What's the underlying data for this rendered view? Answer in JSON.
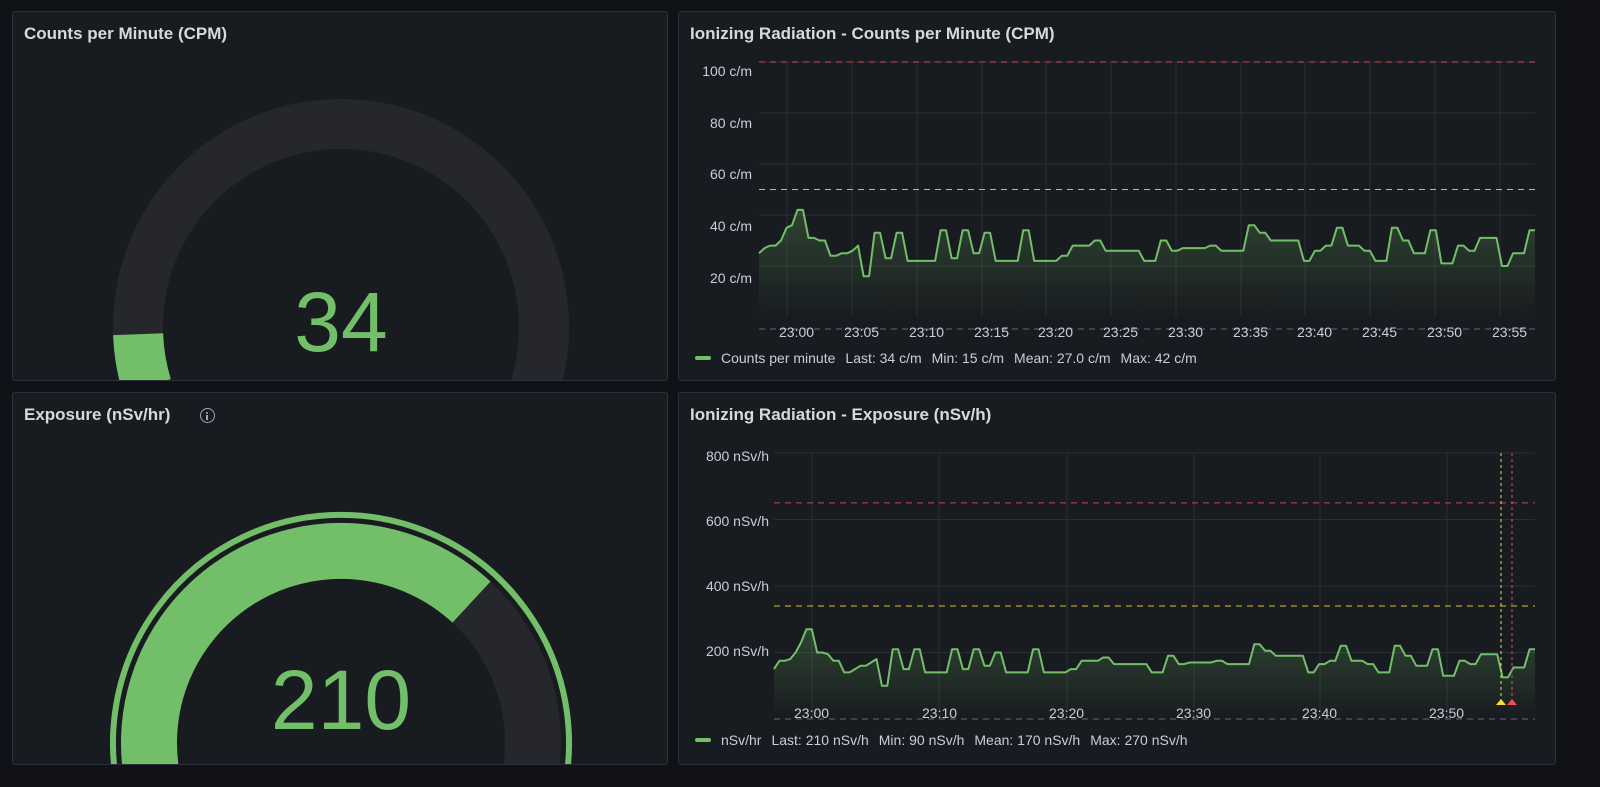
{
  "colors": {
    "green": "#73bf69",
    "track": "#25272d",
    "red": "#f2495c",
    "yellow": "#fade2a",
    "bg": "#181b1f"
  },
  "panels": {
    "cpm_gauge": {
      "title": "Counts per Minute (CPM)",
      "value": "34",
      "min": 0,
      "max": 100,
      "fraction": 0.34
    },
    "exposure_gauge": {
      "title": "Exposure (nSv/hr)",
      "value": "210",
      "info_icon": "info-icon",
      "fraction": 0.7
    },
    "cpm_chart": {
      "title": "Ionizing Radiation - Counts per Minute (CPM)",
      "y_ticks": [
        "100 c/m",
        "80 c/m",
        "60 c/m",
        "40 c/m",
        "20 c/m"
      ],
      "x_ticks": [
        "23:00",
        "23:05",
        "23:10",
        "23:15",
        "23:20",
        "23:25",
        "23:30",
        "23:35",
        "23:40",
        "23:45",
        "23:50",
        "23:55"
      ],
      "legend": {
        "series": "Counts per minute",
        "last": "Last: 34 c/m",
        "min": "Min: 15 c/m",
        "mean": "Mean: 27.0 c/m",
        "max": "Max: 42 c/m"
      }
    },
    "exposure_chart": {
      "title": "Ionizing Radiation - Exposure (nSv/h)",
      "y_ticks": [
        "800 nSv/h",
        "600 nSv/h",
        "400 nSv/h",
        "200 nSv/h"
      ],
      "x_ticks": [
        "23:00",
        "23:10",
        "23:20",
        "23:30",
        "23:40",
        "23:50"
      ],
      "legend": {
        "series": "nSv/hr",
        "last": "Last: 210 nSv/h",
        "min": "Min: 90 nSv/h",
        "mean": "Mean: 170 nSv/h",
        "max": "Max: 270 nSv/h"
      }
    }
  },
  "chart_data": [
    {
      "type": "line",
      "title": "Ionizing Radiation - Counts per Minute (CPM)",
      "unit": "c/m",
      "ylim": [
        0,
        100
      ],
      "x_range": [
        "22:58",
        "23:56"
      ],
      "thresholds": [
        {
          "value": 50,
          "color": "#fade2a"
        },
        {
          "value": 100,
          "color": "#f2495c"
        }
      ],
      "series": [
        {
          "name": "Counts per minute",
          "color": "#73bf69",
          "values": [
            25,
            27,
            28,
            28,
            30,
            35,
            36,
            42,
            42,
            31,
            31,
            30,
            30,
            24,
            24,
            25,
            25,
            26,
            28,
            16,
            16,
            33,
            33,
            23,
            23,
            33,
            33,
            22,
            22,
            22,
            22,
            22,
            22,
            34,
            34,
            23,
            23,
            34,
            34,
            25,
            25,
            33,
            33,
            22,
            22,
            22,
            22,
            22,
            34,
            34,
            22,
            22,
            22,
            22,
            22,
            24,
            24,
            28,
            28,
            28,
            28,
            30,
            30,
            26,
            26,
            26,
            26,
            26,
            26,
            26,
            22,
            22,
            22,
            30,
            30,
            26,
            26,
            27,
            27,
            27,
            27,
            27,
            28,
            28,
            26,
            26,
            26,
            26,
            26,
            36,
            36,
            33,
            33,
            30,
            30,
            30,
            30,
            30,
            30,
            22,
            22,
            26,
            26,
            28,
            28,
            35,
            35,
            28,
            28,
            28,
            26,
            26,
            22,
            22,
            22,
            35,
            35,
            30,
            30,
            25,
            25,
            25,
            34,
            34,
            21,
            21,
            21,
            28,
            28,
            26,
            26,
            31,
            31,
            31,
            31,
            20,
            20,
            25,
            25,
            25,
            34,
            34
          ]
        }
      ]
    },
    {
      "type": "line",
      "title": "Ionizing Radiation - Exposure (nSv/h)",
      "unit": "nSv/h",
      "ylim": [
        0,
        800
      ],
      "x_range": [
        "22:58",
        "23:56"
      ],
      "thresholds": [
        {
          "value": 340,
          "color": "#fade2a"
        },
        {
          "value": 650,
          "color": "#f2495c"
        }
      ],
      "series": [
        {
          "name": "nSv/hr",
          "color": "#73bf69",
          "values": [
            150,
            175,
            175,
            180,
            200,
            230,
            270,
            270,
            200,
            200,
            195,
            175,
            175,
            140,
            140,
            150,
            160,
            160,
            170,
            180,
            100,
            100,
            210,
            210,
            150,
            150,
            210,
            210,
            140,
            140,
            140,
            140,
            140,
            210,
            210,
            150,
            150,
            210,
            210,
            160,
            160,
            200,
            200,
            140,
            140,
            140,
            140,
            140,
            210,
            210,
            140,
            140,
            140,
            140,
            140,
            150,
            150,
            175,
            175,
            175,
            175,
            185,
            185,
            165,
            165,
            165,
            165,
            165,
            165,
            165,
            140,
            140,
            140,
            190,
            190,
            165,
            165,
            170,
            170,
            170,
            170,
            170,
            175,
            175,
            165,
            165,
            165,
            165,
            165,
            225,
            225,
            205,
            205,
            190,
            190,
            190,
            190,
            190,
            190,
            140,
            140,
            165,
            165,
            175,
            175,
            220,
            220,
            175,
            175,
            175,
            165,
            165,
            140,
            140,
            140,
            220,
            220,
            190,
            190,
            160,
            160,
            160,
            210,
            210,
            130,
            130,
            130,
            175,
            175,
            165,
            165,
            195,
            195,
            195,
            195,
            125,
            125,
            155,
            155,
            155,
            210,
            210
          ]
        }
      ]
    }
  ]
}
